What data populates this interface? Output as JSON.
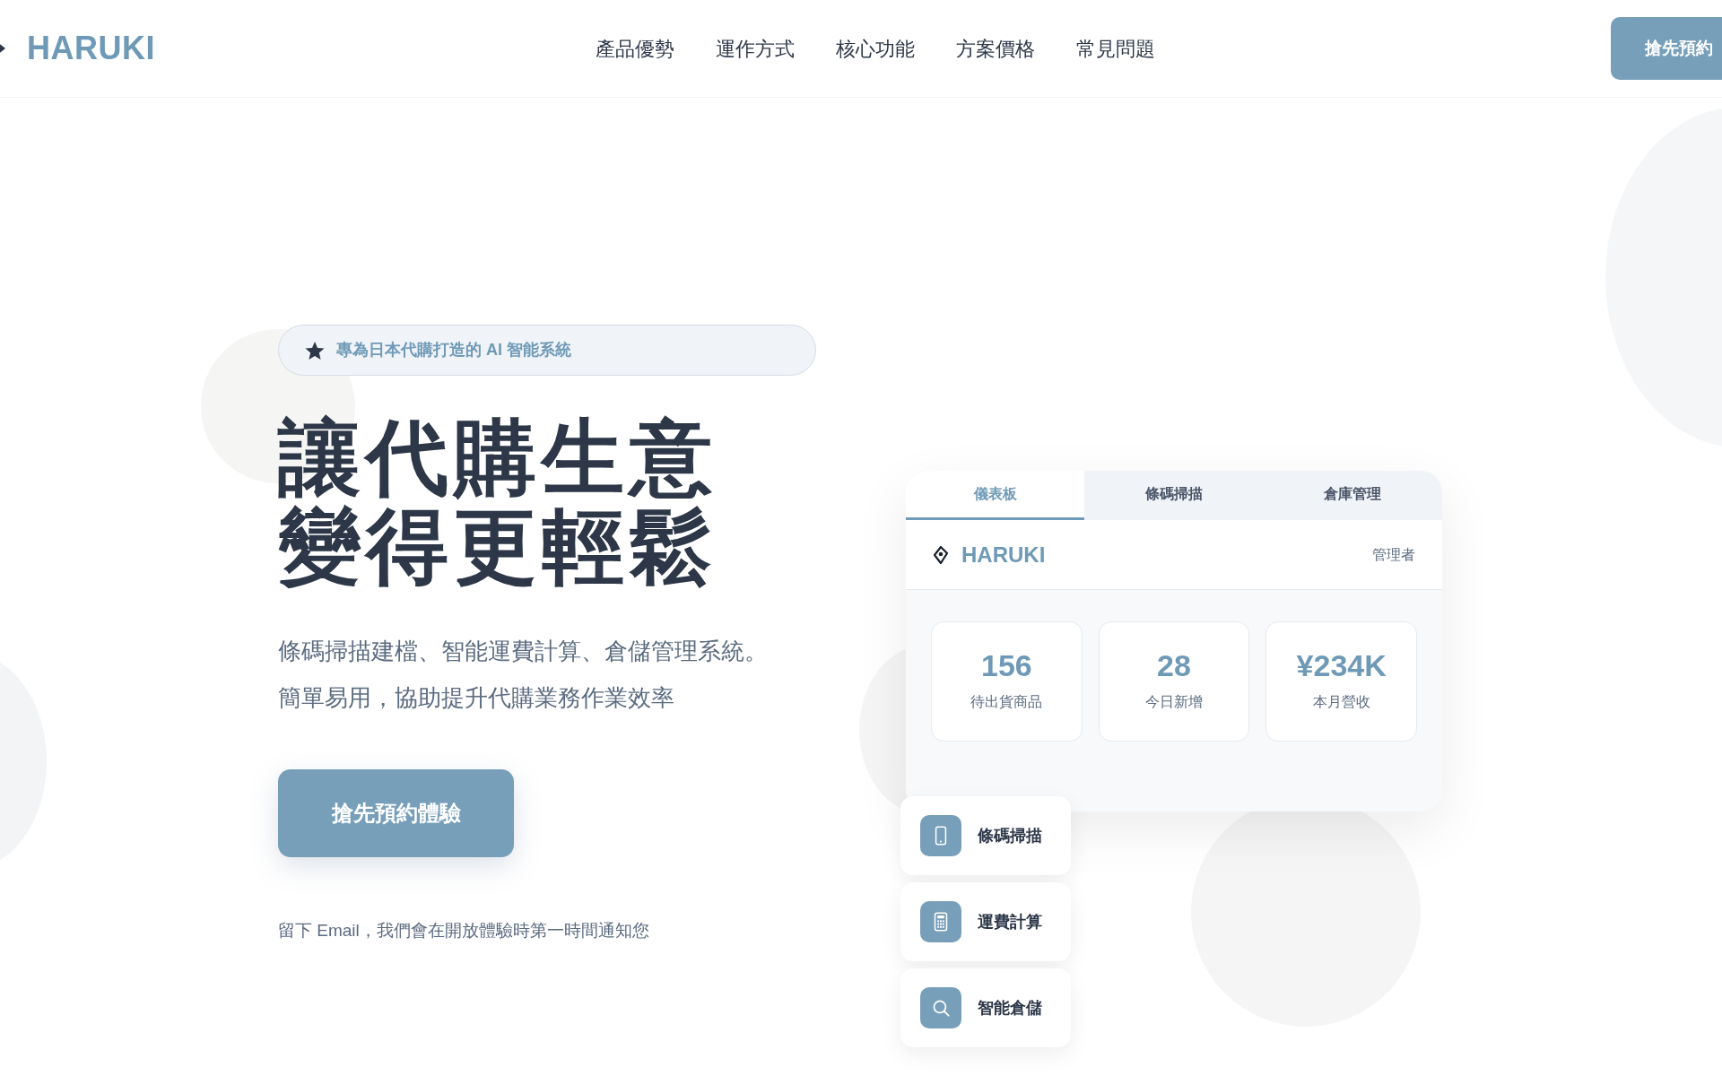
{
  "header": {
    "brand": "HARUKI",
    "nav": [
      "產品優勢",
      "運作方式",
      "核心功能",
      "方案價格",
      "常見問題"
    ],
    "cta": "搶先預約"
  },
  "hero": {
    "badge": "專為日本代購打造的 AI 智能系統",
    "title_lines": [
      "讓代購生意",
      "變得更輕鬆"
    ],
    "subtitle_lines": [
      "條碼掃描建檔、智能運費計算、倉儲管理系統。",
      "簡單易用，協助提升代購業務作業效率"
    ],
    "button": "搶先預約體驗",
    "note": "留下 Email，我們會在開放體驗時第一時間通知您"
  },
  "dashboard": {
    "tabs": [
      {
        "label": "儀表板",
        "selected": true
      },
      {
        "label": "條碼掃描",
        "selected": false
      },
      {
        "label": "倉庫管理",
        "selected": false
      }
    ],
    "brand": "HARUKI",
    "role": "管理者",
    "stats": [
      {
        "value": "156",
        "label": "待出貨商品"
      },
      {
        "value": "28",
        "label": "今日新增"
      },
      {
        "value": "¥234K",
        "label": "本月營收"
      }
    ]
  },
  "features": [
    {
      "kind": "phone",
      "label": "條碼掃描"
    },
    {
      "kind": "calculator",
      "label": "運費計算"
    },
    {
      "kind": "search",
      "label": "智能倉儲"
    }
  ]
}
